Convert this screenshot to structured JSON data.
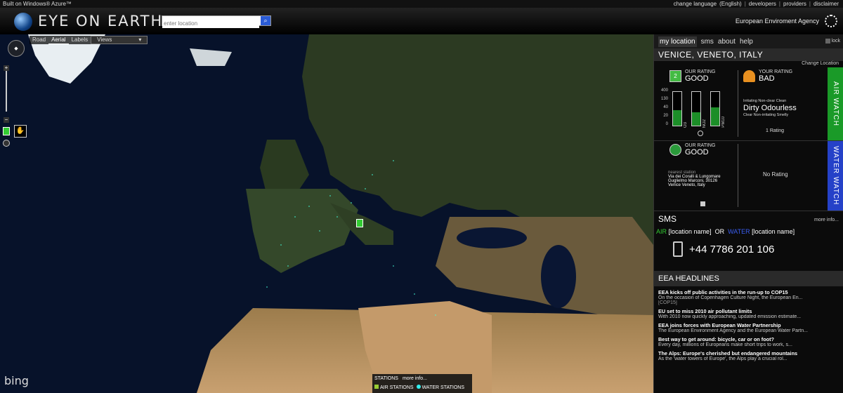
{
  "topbar": {
    "built_on": "Built on Windows® Azure™",
    "links": [
      "change language",
      "(English)",
      "|",
      "developers",
      "|",
      "providers",
      "|",
      "disclaimer"
    ]
  },
  "header": {
    "logo_text": "EYE ON EARTH",
    "search_placeholder": "enter location",
    "search_icon": "search-icon",
    "agency": "European Enviroment Agency"
  },
  "map": {
    "toolbar": {
      "road": "Road",
      "aerial": "Aerial",
      "labels": "Labels",
      "views": "Views"
    },
    "bing": "bing",
    "stations": {
      "title": "STATIONS",
      "more": "more info...",
      "air": "AIR STATIONS",
      "water": "WATER STATIONS"
    }
  },
  "panel": {
    "tabs": [
      "my location",
      "sms",
      "about",
      "help"
    ],
    "lock": "lock",
    "location": "VENICE, VENETO, ITALY",
    "change_location": "Change Location",
    "air": {
      "tag": "AIR WATCH",
      "our_rating_label": "OUR RATING",
      "our_rating_value": "GOOD",
      "our_rating_badge": "2",
      "your_rating_label": "YOUR RATING",
      "your_rating_value": "BAD",
      "axis": [
        "400",
        "130",
        "40",
        "20",
        "0"
      ],
      "bars": [
        {
          "label": "O3",
          "level": 0.45
        },
        {
          "label": "NO2",
          "level": 0.4
        },
        {
          "label": "PM10",
          "level": 0.55
        }
      ],
      "scale_top": "Irritating  Non-clear  Clean",
      "opinion": "Dirty Odourless",
      "scale_bottom": "Clear  Non-irritating  Smelly",
      "count": "1 Rating"
    },
    "water": {
      "tag": "WATER WATCH",
      "our_rating_label": "OUR RATING",
      "our_rating_value": "GOOD",
      "nearest_label": "nearest station",
      "address1": "Via dei Coralli & Lungomare",
      "address2": "Guglielmo Marconi, 30126",
      "address3": "Venice Veneto, Italy",
      "no_rating": "No Rating"
    },
    "sms": {
      "title": "SMS",
      "more": "more info...",
      "air": "AIR",
      "loc1": "[location name]",
      "or": "OR",
      "water": "WATER",
      "loc2": "[location name]",
      "phone": "+44 7786 201 106"
    },
    "eea": {
      "title": "EEA HEADLINES",
      "headlines": [
        {
          "title": "EEA kicks off public activities in the run-up to COP15",
          "desc": "On the occasion of Copenhagen Culture Night, the European En...",
          "extra": "[COP15]"
        },
        {
          "title": "EU set to miss 2010 air pollutant limits",
          "desc": "With 2010 now quickly approaching, updated emission estimate..."
        },
        {
          "title": "EEA joins forces with European Water Partnership",
          "desc": "The European Environment Agency and the European Water Partn..."
        },
        {
          "title": "Best way to get around: bicycle, car or on foot?",
          "desc": "Every day, millions of Europeans make short trips to work, s..."
        },
        {
          "title": "The Alps: Europe's cherished but endangered mountains",
          "desc": "As the 'water towers of Europe', the Alps play a crucial rol..."
        }
      ]
    }
  }
}
